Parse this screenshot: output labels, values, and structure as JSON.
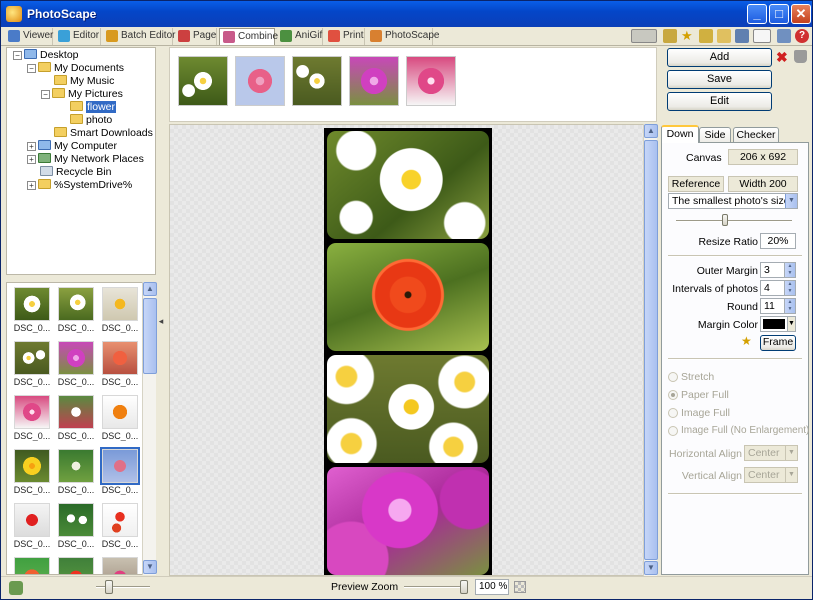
{
  "window": {
    "title": "PhotoScape",
    "minimize": "_",
    "maximize": "□",
    "close": "✕"
  },
  "tabs": [
    {
      "label": "Viewer",
      "color": "#4a7bc8"
    },
    {
      "label": "Editor",
      "color": "#3aa0d8"
    },
    {
      "label": "Batch Editor",
      "color": "#d89a20"
    },
    {
      "label": "Page",
      "color": "#cc4040"
    },
    {
      "label": "Combine",
      "color": "#c85a8a"
    },
    {
      "label": "AniGif",
      "color": "#4c9040"
    },
    {
      "label": "Print",
      "color": "#e05040"
    },
    {
      "label": "PhotoScape",
      "color": "#d88030"
    }
  ],
  "active_tab": "Combine",
  "tree": {
    "items": [
      {
        "label": "Desktop",
        "icon": "desktop-icon",
        "expander": "−"
      },
      {
        "label": "My Documents",
        "icon": "folder-icon",
        "expander": "−"
      },
      {
        "label": "My Music",
        "icon": "folder-icon",
        "expander": ""
      },
      {
        "label": "My Pictures",
        "icon": "folder-icon",
        "expander": "−"
      },
      {
        "label": "flower",
        "icon": "folder-icon",
        "expander": "",
        "selected": true
      },
      {
        "label": "photo",
        "icon": "folder-icon",
        "expander": ""
      },
      {
        "label": "Smart Downloads",
        "icon": "folder-icon",
        "expander": ""
      },
      {
        "label": "My Computer",
        "icon": "computer-icon",
        "expander": "+"
      },
      {
        "label": "My Network Places",
        "icon": "network-icon",
        "expander": "+"
      },
      {
        "label": "Recycle Bin",
        "icon": "recycle-bin-icon",
        "expander": ""
      },
      {
        "label": "%SystemDrive%",
        "icon": "folder-icon",
        "expander": "+"
      }
    ]
  },
  "thumbnails": {
    "caption": "DSC_0...",
    "count": 18
  },
  "preview": {
    "zoom_label": "Preview Zoom",
    "zoom_value": "100 %"
  },
  "actions": {
    "add": "Add",
    "save": "Save",
    "edit": "Edit"
  },
  "settings_tabs": [
    "Down",
    "Side",
    "Checker"
  ],
  "settings": {
    "canvas_label": "Canvas",
    "canvas_value": "206 x 692",
    "reference_label": "Reference",
    "reference_value": "Width 200",
    "size_mode": "The smallest photo's size",
    "resize_ratio_label": "Resize Ratio",
    "resize_ratio_value": "20%",
    "outer_margin_label": "Outer Margin",
    "outer_margin_value": "3",
    "intervals_label": "Intervals of photos",
    "intervals_value": "4",
    "round_label": "Round",
    "round_value": "11",
    "margin_color_label": "Margin Color",
    "margin_color": "#000000",
    "frame_label": "Frame",
    "stretch_label": "Stretch",
    "paper_full_label": "Paper Full",
    "image_full_label": "Image Full",
    "image_full_noenl_label": "Image Full (No Enlargement)",
    "h_align_label": "Horizontal Align",
    "h_align_value": "Center",
    "v_align_label": "Vertical Align",
    "v_align_value": "Center"
  }
}
